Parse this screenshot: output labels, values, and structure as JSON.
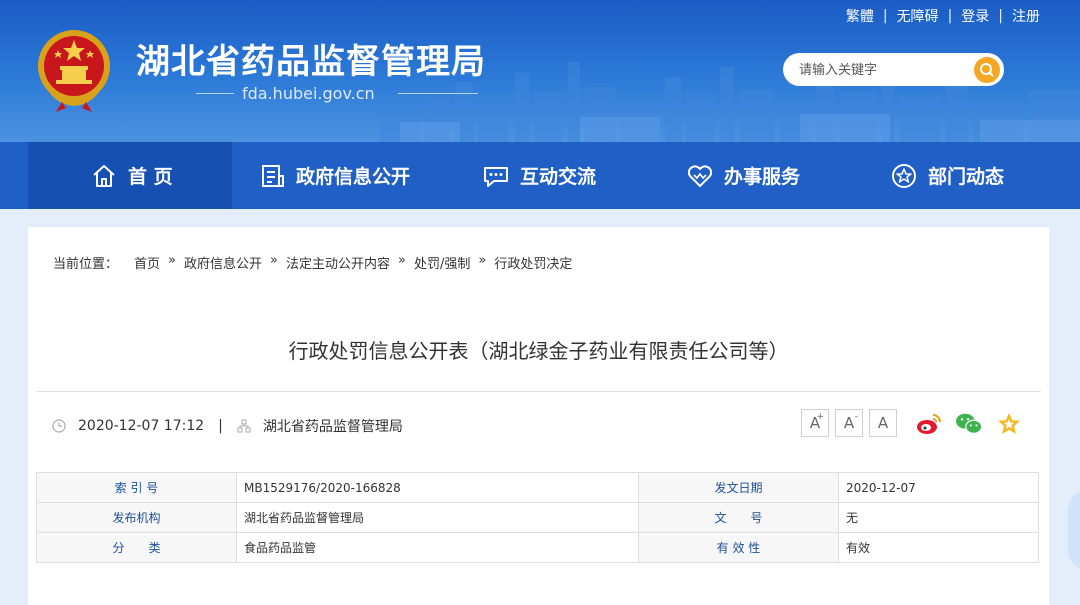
{
  "header": {
    "site_title": "湖北省药品监督管理局",
    "site_domain": "fda.hubei.gov.cn",
    "toplinks": [
      "繁體",
      "无障碍",
      "登录",
      "注册"
    ],
    "search_placeholder": "请输入关键字"
  },
  "nav": {
    "items": [
      {
        "label": "首 页",
        "icon": "home-icon"
      },
      {
        "label": "政府信息公开",
        "icon": "document-icon"
      },
      {
        "label": "互动交流",
        "icon": "chat-icon"
      },
      {
        "label": "办事服务",
        "icon": "heart-icon"
      },
      {
        "label": "部门动态",
        "icon": "star-icon"
      }
    ]
  },
  "breadcrumb": {
    "prefix": "当前位置：",
    "items": [
      "首页",
      "政府信息公开",
      "法定主动公开内容",
      "处罚/强制",
      "行政处罚决定"
    ],
    "separator": "»"
  },
  "article": {
    "title": "行政处罚信息公开表（湖北绿金子药业有限责任公司等）",
    "datetime": "2020-12-07 17:12",
    "meta_sep": "|",
    "source": "湖北省药品监督管理局",
    "font_buttons": [
      "A",
      "A",
      "A"
    ],
    "font_buttons_sup": [
      "+",
      "-"
    ]
  },
  "info_table": {
    "rows": [
      {
        "label1": "索 引 号",
        "value1": "MB1529176/2020-166828",
        "label2": "发文日期",
        "value2": "2020-12-07"
      },
      {
        "label1": "发布机构",
        "value1": "湖北省药品监督管理局",
        "label2": "文　　号",
        "value2": "无"
      },
      {
        "label1": "分　　类",
        "value1": "食品药品监管",
        "label2": "有 效 性",
        "value2": "有效"
      }
    ]
  },
  "colors": {
    "header_blue": "#1a5cc4",
    "nav_blue": "#1f5fc6",
    "nav_active": "#1650b3",
    "search_button": "#f5a623",
    "label_blue": "#1d4f99"
  }
}
